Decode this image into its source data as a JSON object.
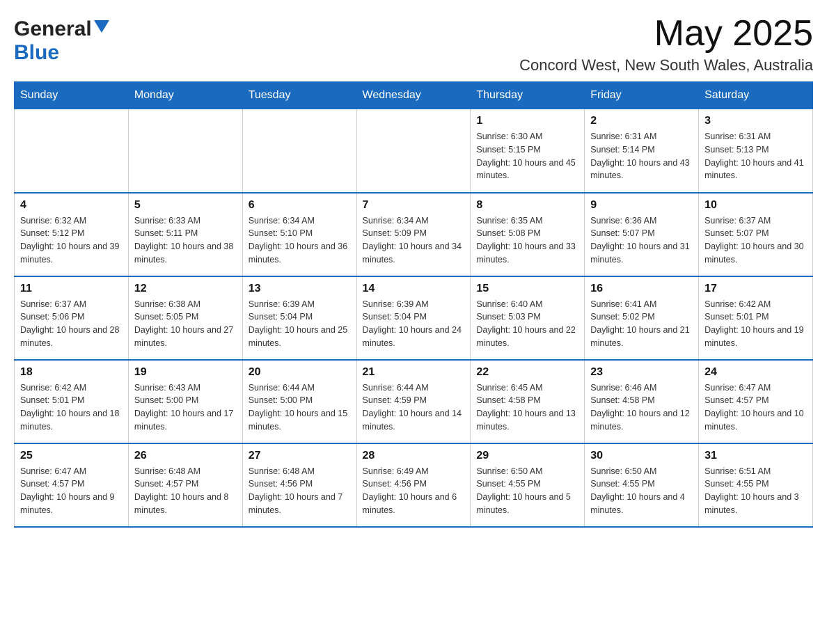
{
  "header": {
    "logo_general": "General",
    "logo_blue": "Blue",
    "month_year": "May 2025",
    "location": "Concord West, New South Wales, Australia"
  },
  "days_of_week": [
    "Sunday",
    "Monday",
    "Tuesday",
    "Wednesday",
    "Thursday",
    "Friday",
    "Saturday"
  ],
  "weeks": [
    [
      {
        "day": "",
        "info": ""
      },
      {
        "day": "",
        "info": ""
      },
      {
        "day": "",
        "info": ""
      },
      {
        "day": "",
        "info": ""
      },
      {
        "day": "1",
        "info": "Sunrise: 6:30 AM\nSunset: 5:15 PM\nDaylight: 10 hours and 45 minutes."
      },
      {
        "day": "2",
        "info": "Sunrise: 6:31 AM\nSunset: 5:14 PM\nDaylight: 10 hours and 43 minutes."
      },
      {
        "day": "3",
        "info": "Sunrise: 6:31 AM\nSunset: 5:13 PM\nDaylight: 10 hours and 41 minutes."
      }
    ],
    [
      {
        "day": "4",
        "info": "Sunrise: 6:32 AM\nSunset: 5:12 PM\nDaylight: 10 hours and 39 minutes."
      },
      {
        "day": "5",
        "info": "Sunrise: 6:33 AM\nSunset: 5:11 PM\nDaylight: 10 hours and 38 minutes."
      },
      {
        "day": "6",
        "info": "Sunrise: 6:34 AM\nSunset: 5:10 PM\nDaylight: 10 hours and 36 minutes."
      },
      {
        "day": "7",
        "info": "Sunrise: 6:34 AM\nSunset: 5:09 PM\nDaylight: 10 hours and 34 minutes."
      },
      {
        "day": "8",
        "info": "Sunrise: 6:35 AM\nSunset: 5:08 PM\nDaylight: 10 hours and 33 minutes."
      },
      {
        "day": "9",
        "info": "Sunrise: 6:36 AM\nSunset: 5:07 PM\nDaylight: 10 hours and 31 minutes."
      },
      {
        "day": "10",
        "info": "Sunrise: 6:37 AM\nSunset: 5:07 PM\nDaylight: 10 hours and 30 minutes."
      }
    ],
    [
      {
        "day": "11",
        "info": "Sunrise: 6:37 AM\nSunset: 5:06 PM\nDaylight: 10 hours and 28 minutes."
      },
      {
        "day": "12",
        "info": "Sunrise: 6:38 AM\nSunset: 5:05 PM\nDaylight: 10 hours and 27 minutes."
      },
      {
        "day": "13",
        "info": "Sunrise: 6:39 AM\nSunset: 5:04 PM\nDaylight: 10 hours and 25 minutes."
      },
      {
        "day": "14",
        "info": "Sunrise: 6:39 AM\nSunset: 5:04 PM\nDaylight: 10 hours and 24 minutes."
      },
      {
        "day": "15",
        "info": "Sunrise: 6:40 AM\nSunset: 5:03 PM\nDaylight: 10 hours and 22 minutes."
      },
      {
        "day": "16",
        "info": "Sunrise: 6:41 AM\nSunset: 5:02 PM\nDaylight: 10 hours and 21 minutes."
      },
      {
        "day": "17",
        "info": "Sunrise: 6:42 AM\nSunset: 5:01 PM\nDaylight: 10 hours and 19 minutes."
      }
    ],
    [
      {
        "day": "18",
        "info": "Sunrise: 6:42 AM\nSunset: 5:01 PM\nDaylight: 10 hours and 18 minutes."
      },
      {
        "day": "19",
        "info": "Sunrise: 6:43 AM\nSunset: 5:00 PM\nDaylight: 10 hours and 17 minutes."
      },
      {
        "day": "20",
        "info": "Sunrise: 6:44 AM\nSunset: 5:00 PM\nDaylight: 10 hours and 15 minutes."
      },
      {
        "day": "21",
        "info": "Sunrise: 6:44 AM\nSunset: 4:59 PM\nDaylight: 10 hours and 14 minutes."
      },
      {
        "day": "22",
        "info": "Sunrise: 6:45 AM\nSunset: 4:58 PM\nDaylight: 10 hours and 13 minutes."
      },
      {
        "day": "23",
        "info": "Sunrise: 6:46 AM\nSunset: 4:58 PM\nDaylight: 10 hours and 12 minutes."
      },
      {
        "day": "24",
        "info": "Sunrise: 6:47 AM\nSunset: 4:57 PM\nDaylight: 10 hours and 10 minutes."
      }
    ],
    [
      {
        "day": "25",
        "info": "Sunrise: 6:47 AM\nSunset: 4:57 PM\nDaylight: 10 hours and 9 minutes."
      },
      {
        "day": "26",
        "info": "Sunrise: 6:48 AM\nSunset: 4:57 PM\nDaylight: 10 hours and 8 minutes."
      },
      {
        "day": "27",
        "info": "Sunrise: 6:48 AM\nSunset: 4:56 PM\nDaylight: 10 hours and 7 minutes."
      },
      {
        "day": "28",
        "info": "Sunrise: 6:49 AM\nSunset: 4:56 PM\nDaylight: 10 hours and 6 minutes."
      },
      {
        "day": "29",
        "info": "Sunrise: 6:50 AM\nSunset: 4:55 PM\nDaylight: 10 hours and 5 minutes."
      },
      {
        "day": "30",
        "info": "Sunrise: 6:50 AM\nSunset: 4:55 PM\nDaylight: 10 hours and 4 minutes."
      },
      {
        "day": "31",
        "info": "Sunrise: 6:51 AM\nSunset: 4:55 PM\nDaylight: 10 hours and 3 minutes."
      }
    ]
  ]
}
